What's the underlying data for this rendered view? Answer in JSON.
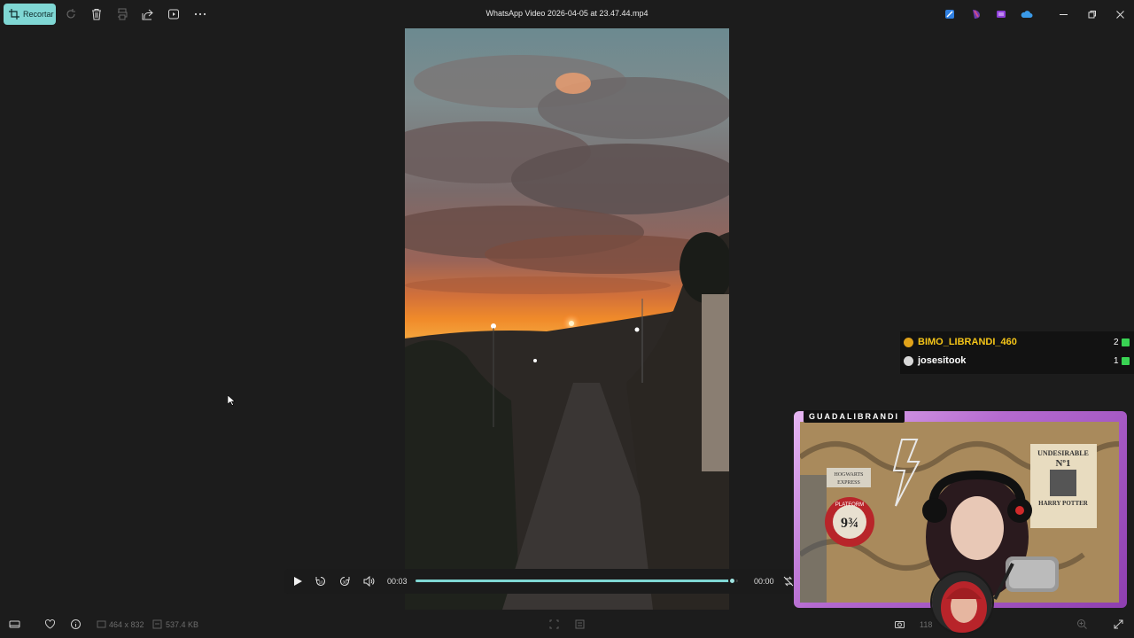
{
  "toolbar": {
    "crop_label": "Recortar",
    "title": "WhatsApp Video 2026-04-05 at 23.47.44.mp4"
  },
  "player": {
    "current_time": "00:03",
    "end_time": "00:00",
    "progress": 0.98
  },
  "status": {
    "dimensions": "464 x 832",
    "file_size": "537.4 KB",
    "zoom": "118"
  },
  "chat": {
    "entries": [
      {
        "name": "BIMO_LIBRANDI_460",
        "count": "2",
        "name_color": "#f5c518",
        "badge_color": "#e0a21a"
      },
      {
        "name": "josesitook",
        "count": "1",
        "name_color": "#ffffff",
        "badge_color": "#d8d8d8"
      }
    ]
  },
  "webcam": {
    "channel_name": "GUADALIBRANDI",
    "poster_text_1": "UNDESIRABLE",
    "poster_text_2": "Nº1",
    "poster_text_3": "HARRY POTTER",
    "sign_text_1": "HOGWARTS",
    "sign_text_2": "EXPRESS",
    "platform_text": "PLATFORM",
    "platform_number": "9¾"
  },
  "colors": {
    "accent": "#7fd7d4",
    "background": "#1c1c1c"
  }
}
